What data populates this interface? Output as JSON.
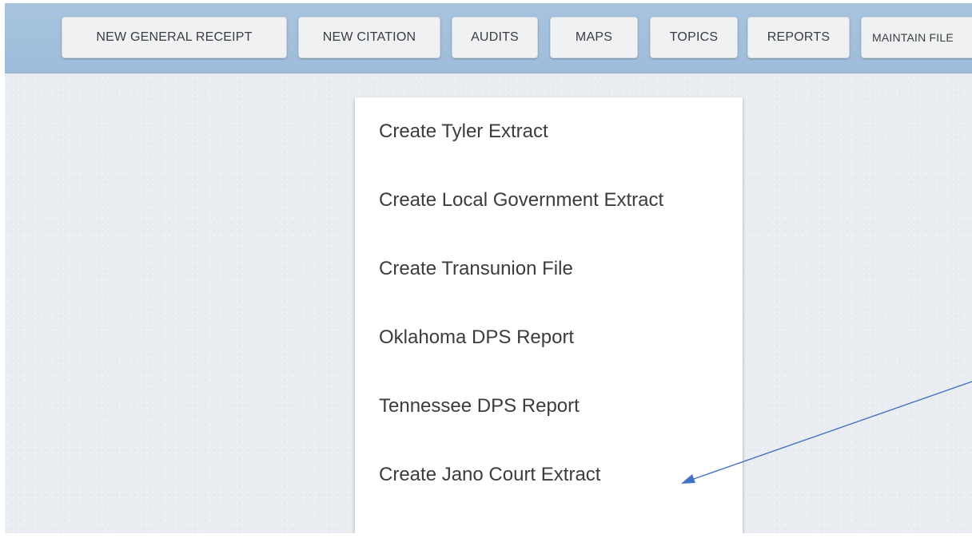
{
  "toolbar": {
    "buttons": [
      {
        "label": "NEW GENERAL RECEIPT"
      },
      {
        "label": "NEW CITATION"
      },
      {
        "label": "AUDITS"
      },
      {
        "label": "MAPS"
      },
      {
        "label": "TOPICS"
      },
      {
        "label": "REPORTS"
      },
      {
        "label": "MAINTAIN FILE"
      }
    ]
  },
  "menu": {
    "items": [
      {
        "label": "Create Tyler Extract"
      },
      {
        "label": "Create Local Government Extract"
      },
      {
        "label": "Create Transunion File"
      },
      {
        "label": "Oklahoma DPS Report"
      },
      {
        "label": "Tennessee DPS Report"
      },
      {
        "label": "Create Jano Court Extract"
      }
    ]
  },
  "annotation": {
    "color": "#4472c4"
  }
}
